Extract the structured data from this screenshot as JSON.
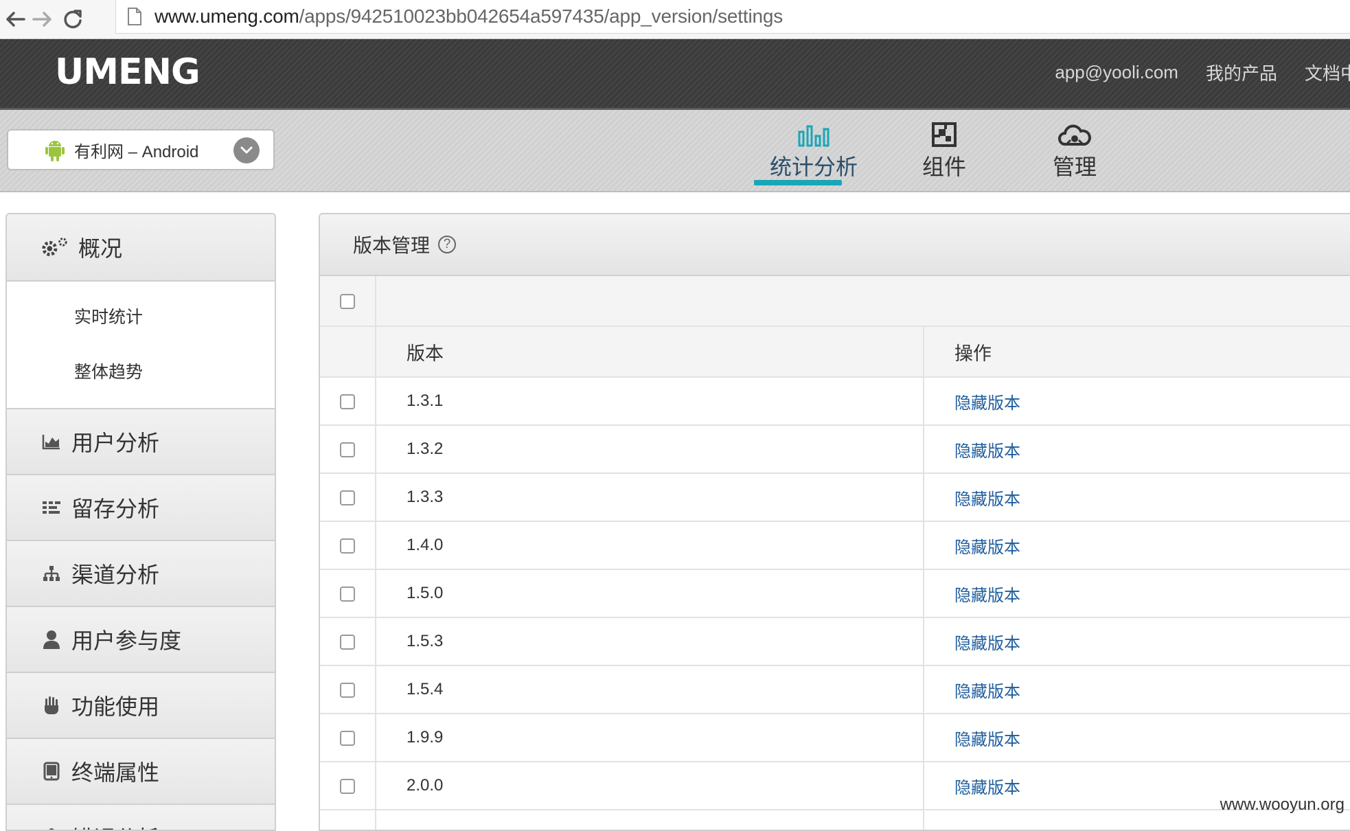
{
  "browser": {
    "url_host": "www.umeng.com",
    "url_path": "/apps/942510023bb042654a597435/app_version/settings"
  },
  "header": {
    "logo": "UMENG",
    "user_email": "app@yooli.com",
    "my_products": "我的产品",
    "docs": "文档中"
  },
  "app_selector": {
    "name": "有利网 – Android"
  },
  "topnav": {
    "items": [
      {
        "label": "统计分析",
        "icon": "bar-chart-icon",
        "active": true
      },
      {
        "label": "组件",
        "icon": "component-icon",
        "active": false
      },
      {
        "label": "管理",
        "icon": "cloud-icon",
        "active": false
      }
    ]
  },
  "sidebar": {
    "overview": "概况",
    "overview_sub": [
      "实时统计",
      "整体趋势"
    ],
    "sections": [
      {
        "label": "用户分析",
        "icon": "area-chart-icon"
      },
      {
        "label": "留存分析",
        "icon": "grid-list-icon"
      },
      {
        "label": "渠道分析",
        "icon": "sitemap-icon"
      },
      {
        "label": "用户参与度",
        "icon": "user-icon"
      },
      {
        "label": "功能使用",
        "icon": "hand-icon"
      },
      {
        "label": "终端属性",
        "icon": "tablet-icon"
      },
      {
        "label": "错误分析",
        "icon": "bug-icon"
      }
    ]
  },
  "panel": {
    "title": "版本管理",
    "help": "?",
    "columns": {
      "version": "版本",
      "action": "操作"
    },
    "rows": [
      {
        "version": "1.3.1",
        "action": "隐藏版本"
      },
      {
        "version": "1.3.2",
        "action": "隐藏版本"
      },
      {
        "version": "1.3.3",
        "action": "隐藏版本"
      },
      {
        "version": "1.4.0",
        "action": "隐藏版本"
      },
      {
        "version": "1.5.0",
        "action": "隐藏版本"
      },
      {
        "version": "1.5.3",
        "action": "隐藏版本"
      },
      {
        "version": "1.5.4",
        "action": "隐藏版本"
      },
      {
        "version": "1.9.9",
        "action": "隐藏版本"
      },
      {
        "version": "2.0.0",
        "action": "隐藏版本"
      }
    ]
  },
  "watermark": "www.wooyun.org",
  "colors": {
    "accent": "#19a6b8",
    "link": "#1f5e9c",
    "header_bg": "#3f3f3f"
  }
}
